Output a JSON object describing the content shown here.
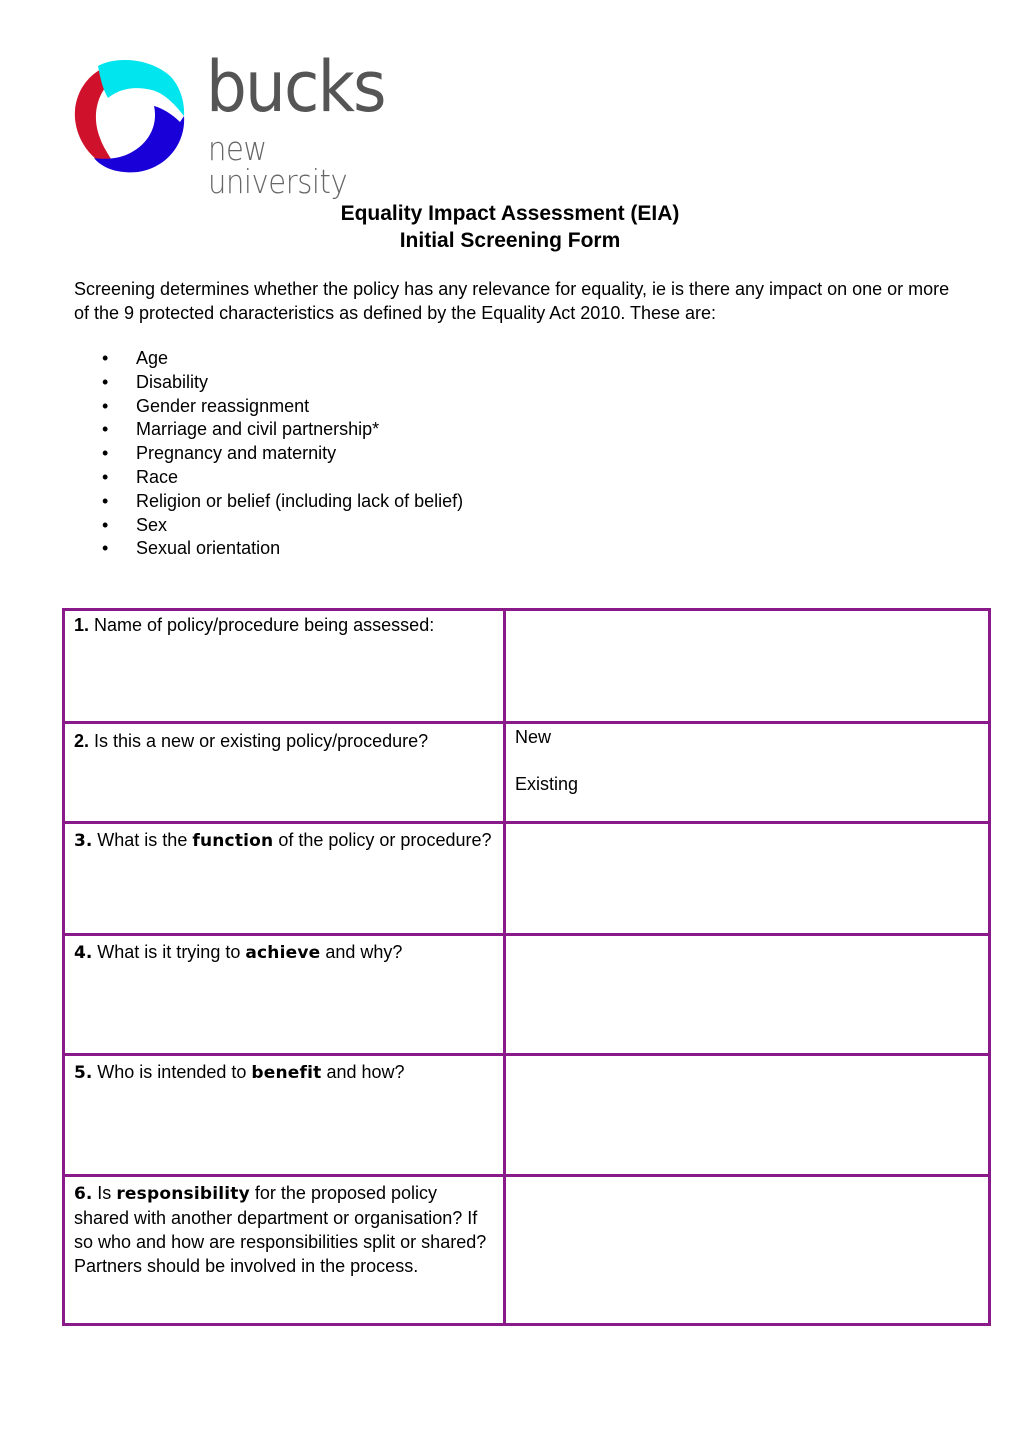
{
  "logo": {
    "name": "bucks",
    "subtitle": "new university",
    "colors": {
      "red": "#d0112b",
      "cyan": "#00e5ee",
      "blue": "#1a00d8",
      "text": "#555555"
    }
  },
  "header": {
    "title_line1": "Equality Impact Assessment (EIA)",
    "title_line2": "Initial Screening Form"
  },
  "intro": {
    "text": "Screening determines whether the policy has any relevance for equality, ie is there any impact on one or more of the 9 protected characteristics as defined by the Equality Act 2010. These are:"
  },
  "characteristics": [
    "Age",
    "Disability",
    "Gender reassignment",
    "Marriage and civil partnership*",
    "Pregnancy and maternity",
    "Race",
    "Religion or belief (including lack of belief)",
    "Sex",
    "Sexual orientation"
  ],
  "bullet": "•",
  "form": {
    "border_color": "#8a1a8a",
    "rows": [
      {
        "num": "1.",
        "pre": " Name of policy/procedure being assessed:",
        "kw": "",
        "post": "",
        "answer": ""
      },
      {
        "num": "2.",
        "pre": " Is this a new or existing policy/procedure?",
        "kw": "",
        "post": "",
        "options": [
          "New",
          "Existing"
        ]
      },
      {
        "num": "3.",
        "pre": " What is the ",
        "kw": "function",
        "post": " of the policy or procedure?",
        "answer": ""
      },
      {
        "num": "4.",
        "pre": " What is it trying to ",
        "kw": "achieve",
        "post": " and why?",
        "answer": ""
      },
      {
        "num": "5.",
        "pre": " Who is intended to ",
        "kw": "benefit",
        "post": " and how?",
        "answer": ""
      },
      {
        "num": "6.",
        "pre": " Is ",
        "kw": "responsibility",
        "post": " for the proposed policy shared with another department or organisation? If so who and how are responsibilities split or shared? Partners should be involved in the process.",
        "answer": ""
      }
    ]
  }
}
